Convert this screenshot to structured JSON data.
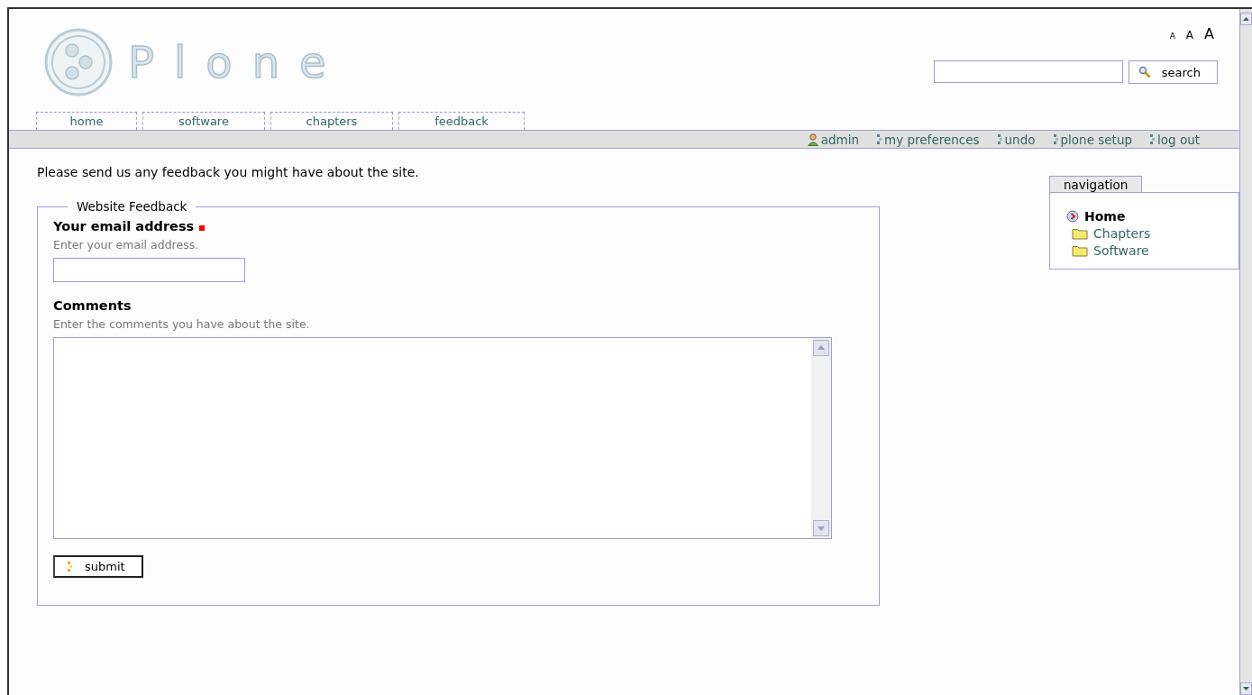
{
  "logo": {
    "text": "Plone"
  },
  "font_size_links": [
    "A",
    "A",
    "A"
  ],
  "search": {
    "button": "search"
  },
  "tabs": [
    {
      "label": "home"
    },
    {
      "label": "software"
    },
    {
      "label": "chapters"
    },
    {
      "label": "feedback"
    }
  ],
  "personal_bar": [
    {
      "label": "admin",
      "kind": "user"
    },
    {
      "label": "my preferences",
      "kind": "link"
    },
    {
      "label": "undo",
      "kind": "link"
    },
    {
      "label": "plone setup",
      "kind": "link"
    },
    {
      "label": "log out",
      "kind": "link"
    }
  ],
  "intro": "Please send us any feedback you might have about the site.",
  "form": {
    "legend": "Website Feedback",
    "fields": [
      {
        "label": "Your email address",
        "required": true,
        "help": "Enter your email address.",
        "kind": "text"
      },
      {
        "label": "Comments",
        "required": false,
        "help": "Enter the comments you have about the site.",
        "kind": "textarea"
      }
    ],
    "submit": "submit"
  },
  "navigation": {
    "title": "navigation",
    "items": [
      {
        "label": "Home",
        "kind": "home",
        "selected": true
      },
      {
        "label": "Chapters",
        "kind": "folder",
        "selected": false
      },
      {
        "label": "Software",
        "kind": "folder",
        "selected": false
      }
    ]
  }
}
